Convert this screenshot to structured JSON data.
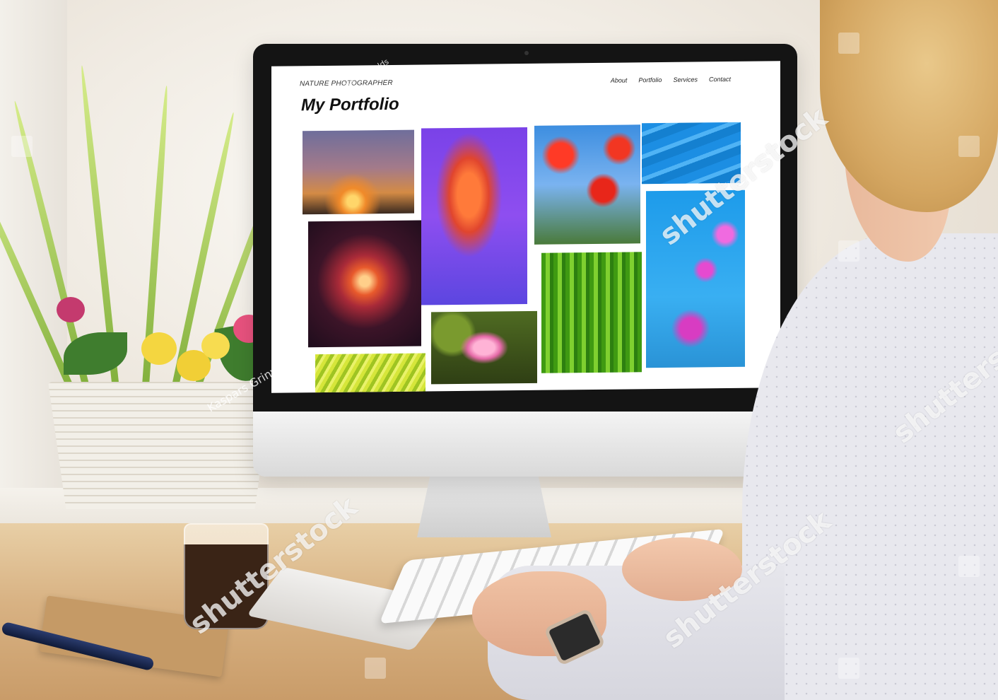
{
  "site": {
    "brand": "NATURE PHOTOGRAPHER",
    "title": "My Portfolio",
    "nav": [
      "About",
      "Portfolio",
      "Services",
      "Contact"
    ]
  },
  "gallery": [
    {
      "subject": "reeds-sunset-photo"
    },
    {
      "subject": "jellyfish-photo"
    },
    {
      "subject": "poppies-photo"
    },
    {
      "subject": "water-ripples-photo"
    },
    {
      "subject": "sundew-plant-photo"
    },
    {
      "subject": "green-grass-photo"
    },
    {
      "subject": "bougainvillea-photo"
    },
    {
      "subject": "water-lily-photo"
    },
    {
      "subject": "palm-leaf-photo"
    }
  ],
  "watermarks": {
    "brand": "shutterstock",
    "author": "Kaspars Grinvalds"
  },
  "colors": {
    "screen_bg": "#ffffff",
    "bezel": "#141414",
    "desk": "#d8b283"
  }
}
